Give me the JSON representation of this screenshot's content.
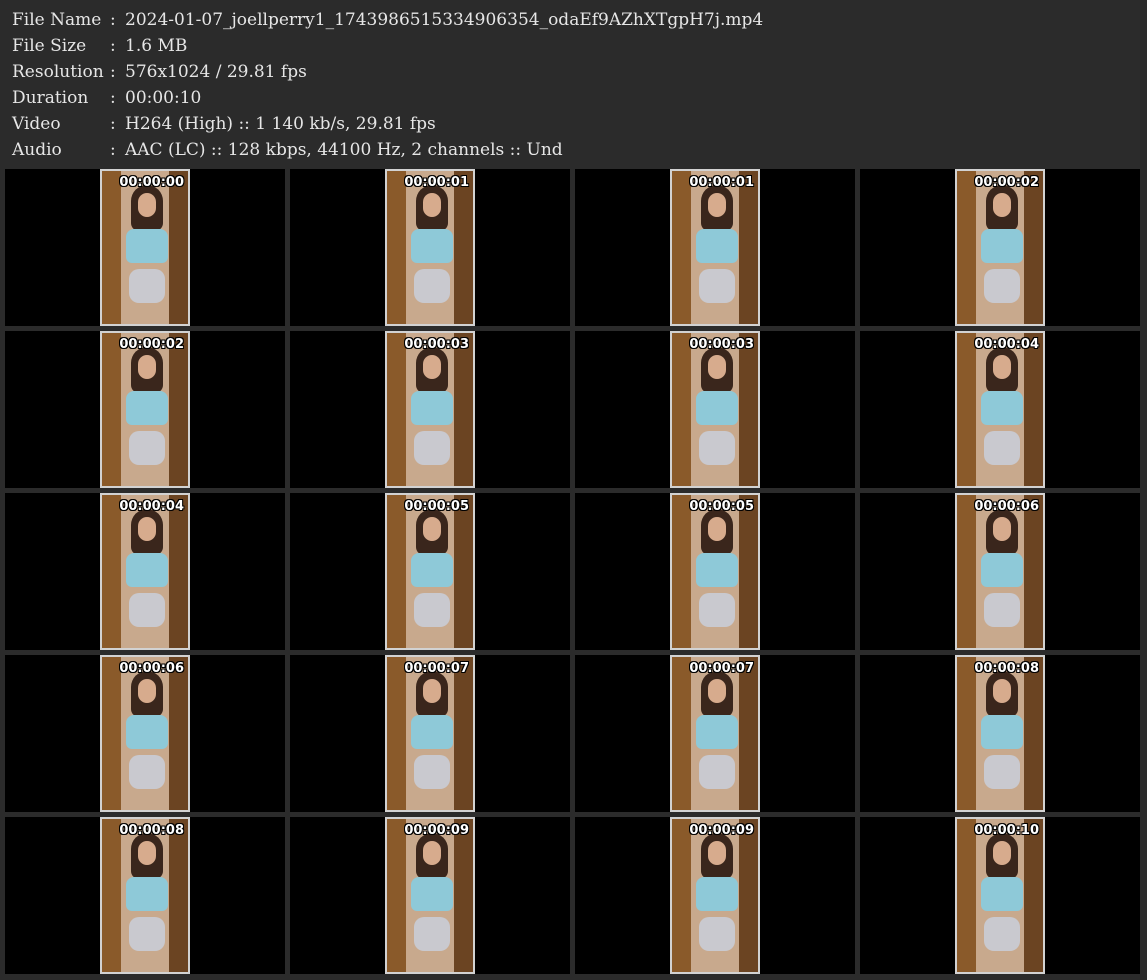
{
  "info": {
    "labels": {
      "file_name": "File Name",
      "file_size": "File Size",
      "resolution": "Resolution",
      "duration": "Duration",
      "video": "Video",
      "audio": "Audio"
    },
    "separator": ":",
    "values": {
      "file_name": "2024-01-07_joellperry1_1743986515334906354_odaEf9AZhXTgpH7j.mp4",
      "file_size": "1.6 MB",
      "resolution": "576x1024 / 29.81 fps",
      "duration": "00:00:10",
      "video": "H264 (High) :: 1 140 kb/s, 29.81 fps",
      "audio": "AAC (LC) :: 128 kbps, 44100 Hz, 2 channels :: Und"
    }
  },
  "thumbnails": [
    {
      "time": "00:00:00"
    },
    {
      "time": "00:00:01"
    },
    {
      "time": "00:00:01"
    },
    {
      "time": "00:00:02"
    },
    {
      "time": "00:00:02"
    },
    {
      "time": "00:00:03"
    },
    {
      "time": "00:00:03"
    },
    {
      "time": "00:00:04"
    },
    {
      "time": "00:00:04"
    },
    {
      "time": "00:00:05"
    },
    {
      "time": "00:00:05"
    },
    {
      "time": "00:00:06"
    },
    {
      "time": "00:00:06"
    },
    {
      "time": "00:00:07"
    },
    {
      "time": "00:00:07"
    },
    {
      "time": "00:00:08"
    },
    {
      "time": "00:00:08"
    },
    {
      "time": "00:00:09"
    },
    {
      "time": "00:00:09"
    },
    {
      "time": "00:00:10"
    }
  ],
  "colors": {
    "background": "#2b2b2b",
    "text": "#e6e6e6",
    "cell": "#000000",
    "thumb_border": "#d2d2d2",
    "door": "#8a5a2a",
    "wall": "#c8a98d",
    "shirt": "#8ec9d8",
    "shorts": "#c9c9cf"
  }
}
